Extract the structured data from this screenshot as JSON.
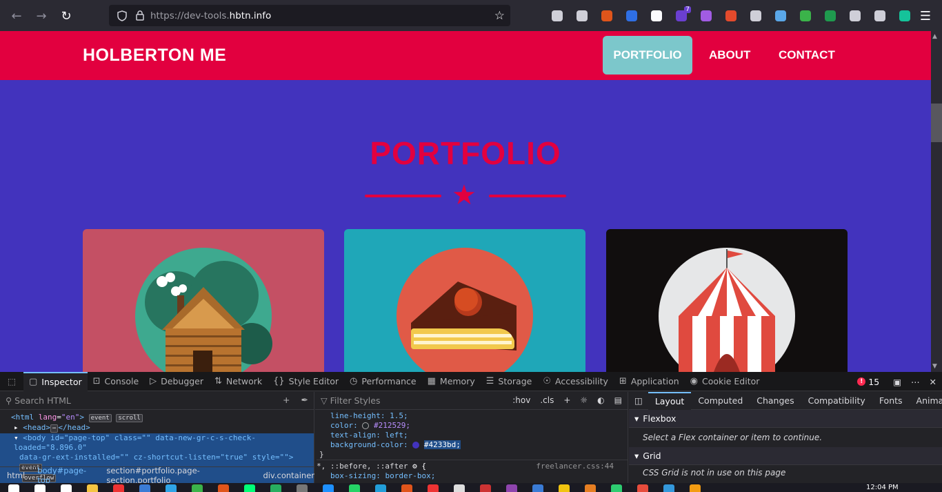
{
  "browser": {
    "url_prefix": "https://dev-tools.",
    "url_domain": "hbtn.info",
    "extensions": [
      {
        "name": "pocket-icon",
        "color": "#cfcfd8"
      },
      {
        "name": "library-icon",
        "color": "#cfcfd8"
      },
      {
        "name": "fox-icon",
        "color": "#e0551b"
      },
      {
        "name": "download-icon",
        "color": "#2f6fe4"
      },
      {
        "name": "mj-icon",
        "color": "#fbfbfe"
      },
      {
        "name": "calendar-badge-icon",
        "color": "#6a3fd1"
      },
      {
        "name": "parentheses-icon",
        "color": "#a15ce3"
      },
      {
        "name": "ball-icon",
        "color": "#e34a2c"
      },
      {
        "name": "cookie-icon",
        "color": "#cfcfd8"
      },
      {
        "name": "cloud-icon",
        "color": "#5aa7e8"
      },
      {
        "name": "globe-icon",
        "color": "#3bb34a"
      },
      {
        "name": "excel-icon",
        "color": "#1f9a4e"
      },
      {
        "name": "pen-icon",
        "color": "#cfcfd8"
      },
      {
        "name": "vee-icon",
        "color": "#cfcfd8"
      },
      {
        "name": "grammarly-icon",
        "color": "#15c39a"
      }
    ],
    "badge_count": "7"
  },
  "site": {
    "brand": "HOLBERTON ME",
    "nav": [
      {
        "label": "PORTFOLIO",
        "active": true
      },
      {
        "label": "ABOUT",
        "active": false
      },
      {
        "label": "CONTACT",
        "active": false
      }
    ],
    "section_title": "PORTFOLIO",
    "colors": {
      "primary": "#e2003f",
      "background": "#4233bd",
      "nav_active": "#7cc7cb"
    },
    "cards": [
      {
        "name": "cabin",
        "bg": "#c45064"
      },
      {
        "name": "cake",
        "bg": "#1fa7b8"
      },
      {
        "name": "circus",
        "bg": "#110e0e"
      }
    ]
  },
  "devtools": {
    "tabs": [
      {
        "label": "Inspector",
        "icon": "inspector-icon"
      },
      {
        "label": "Console",
        "icon": "console-icon"
      },
      {
        "label": "Debugger",
        "icon": "debugger-icon"
      },
      {
        "label": "Network",
        "icon": "network-icon"
      },
      {
        "label": "Style Editor",
        "icon": "style-editor-icon"
      },
      {
        "label": "Performance",
        "icon": "performance-icon"
      },
      {
        "label": "Memory",
        "icon": "memory-icon"
      },
      {
        "label": "Storage",
        "icon": "storage-icon"
      },
      {
        "label": "Accessibility",
        "icon": "accessibility-icon"
      },
      {
        "label": "Application",
        "icon": "application-icon"
      },
      {
        "label": "Cookie Editor",
        "icon": "cookie-icon"
      }
    ],
    "error_count": "15",
    "search_placeholder": "Search HTML",
    "filter_placeholder": "Filter Styles",
    "hov": ":hov",
    "cls": ".cls",
    "markup": {
      "html_line_tag": "<html",
      "html_lang_attr": "lang",
      "html_lang_val": "\"en\"",
      "html_close": ">",
      "event_badge": "event",
      "scroll_badge": "scroll",
      "head_line": "<head>",
      "head_close": "</head>",
      "body_line_1": "<body id=\"page-top\" class=\"\" data-new-gr-c-s-check-loaded=\"8.896.0\"",
      "body_line_2": "data-gr-ext-installed=\"\" cz-shortcut-listen=\"true\" style=\"\">",
      "overflow_badge": "overflow"
    },
    "breadcrumbs": [
      "html",
      "body#page-top",
      "section#portfolio.page-section.portfolio",
      "div.container"
    ],
    "rules": {
      "line_height": "line-height: 1.5;",
      "color_prop": "color:",
      "color_val": "#212529;",
      "text_align": "text-align: left;",
      "bg_prop": "background-color:",
      "bg_val": "#4233bd;",
      "close_brace": "}",
      "universal_selector": "*, ::before, ::after",
      "universal_brace": "{",
      "source": "freelancer.css:44",
      "box_sizing": "box-sizing: border-box;"
    },
    "layout_tabs": [
      "Layout",
      "Computed",
      "Changes",
      "Compatibility",
      "Fonts",
      "Animatio"
    ],
    "flexbox_title": "Flexbox",
    "flexbox_msg": "Select a Flex container or item to continue.",
    "grid_title": "Grid",
    "grid_msg": "CSS Grid is not in use on this page"
  },
  "taskbar": {
    "clock": "12:04 PM"
  }
}
